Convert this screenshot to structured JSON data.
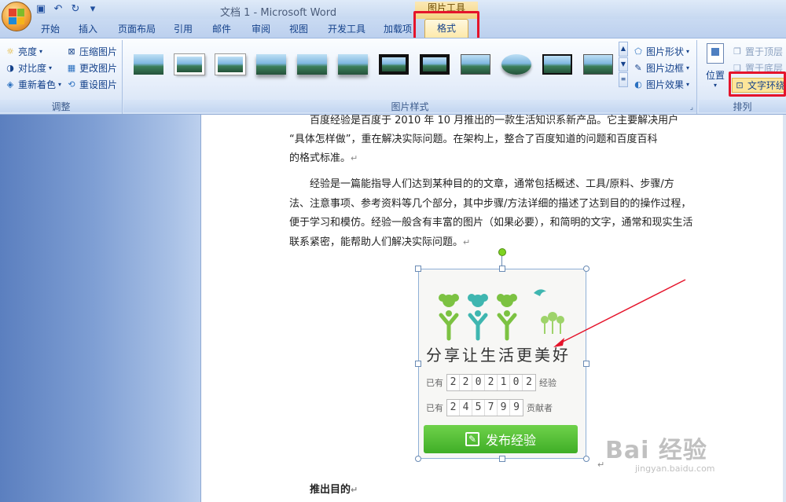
{
  "window": {
    "title": "文档 1 - Microsoft Word",
    "context_tab_group": "图片工具"
  },
  "quick_access": {
    "save_icon": "save-icon",
    "undo_icon": "undo-icon",
    "redo_icon": "redo-icon",
    "customize_glyph": "▾"
  },
  "tabs": [
    {
      "label": "开始"
    },
    {
      "label": "插入"
    },
    {
      "label": "页面布局"
    },
    {
      "label": "引用"
    },
    {
      "label": "邮件"
    },
    {
      "label": "审阅"
    },
    {
      "label": "视图"
    },
    {
      "label": "开发工具"
    },
    {
      "label": "加载项"
    }
  ],
  "active_tab": "格式",
  "ribbon": {
    "adjust": {
      "label": "调整",
      "brightness": "亮度",
      "contrast": "对比度",
      "recolor": "重新着色",
      "compress": "压缩图片",
      "change": "更改图片",
      "reset": "重设图片"
    },
    "styles": {
      "label": "图片样式",
      "shape": "图片形状",
      "border": "图片边框",
      "effects": "图片效果"
    },
    "arrange": {
      "label": "排列",
      "position": "位置",
      "bring_front": "置于顶层",
      "send_back": "置于底层",
      "text_wrap": "文字环绕"
    }
  },
  "document": {
    "line1": "百度经验是百度于 2010 年 10 月推出的一款生活知识系新产品。它主要解决用户",
    "line2": "“具体怎样做”，重在解决实际问题。在架构上，整合了百度知道的问题和百度百科",
    "line3": "的格式标准。",
    "para2": "经验是一篇能指导人们达到某种目的的文章，通常包括概述、工具/原料、步骤/方法、注意事项、参考资料等几个部分，其中步骤/方法详细的描述了达到目的的操作过程，便于学习和模仿。经验一般含有丰富的图片（如果必要），和简明的文字，通常和现实生活联系紧密，能帮助人们解决实际问题。",
    "para_mark": "↵",
    "bottom_heading": "推出目的"
  },
  "inserted_image": {
    "slogan": "分享让生活更美好",
    "count1_prefix": "已有",
    "count1_digits": [
      "2",
      "2",
      "0",
      "2",
      "1",
      "0",
      "2"
    ],
    "count1_suffix": "经验",
    "count2_prefix": "已有",
    "count2_digits": [
      "2",
      "4",
      "5",
      "7",
      "9",
      "9"
    ],
    "count2_suffix": "贡献者",
    "publish_button": "发布经验"
  },
  "watermark": {
    "brand": "Bai 经验",
    "url": "jingyan.baidu.com"
  },
  "colors": {
    "highlight": "#e5142b",
    "publish_green": "#4cbc2e",
    "arrow_red": "#e5142b"
  }
}
